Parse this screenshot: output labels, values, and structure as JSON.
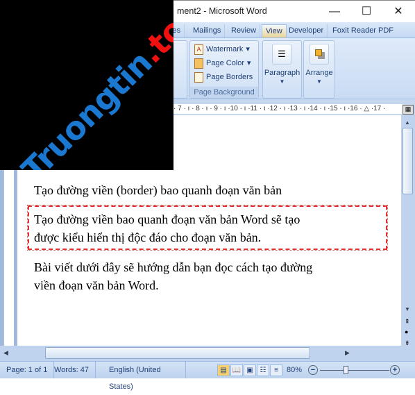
{
  "window": {
    "title": "ment2 - Microsoft Word",
    "minimize": "—",
    "maximize": "☐",
    "close": "✕"
  },
  "tabs": [
    {
      "label": "ces"
    },
    {
      "label": "Mailings"
    },
    {
      "label": "Review"
    },
    {
      "label": "View",
      "active": true
    },
    {
      "label": "Developer"
    },
    {
      "label": "Foxit Reader PDF"
    }
  ],
  "help": "?",
  "ribbon": {
    "page_background": {
      "label": "Page Background",
      "items": [
        {
          "label": "Watermark",
          "icon": "watermark-icon"
        },
        {
          "label": "Page Color",
          "icon": "page-color-icon"
        },
        {
          "label": "Page Borders",
          "icon": "page-borders-icon"
        }
      ]
    },
    "paragraph": {
      "label": "Paragraph"
    },
    "arrange": {
      "label": "Arrange"
    }
  },
  "ruler": "· 7 · ı · 8 · ı · 9 · ı ·10 · ı ·11 · ı ·12 · ı ·13 · ı ·14 · ı ·15 · ı ·16 · △ ·17 ·",
  "watermark_logo": "Truongtin.top",
  "document": {
    "heading": "Tạo đường viền (border) bao quanh đoạn văn bản",
    "bordered_paragraph": [
      "Tạo đường viền bao quanh đoạn văn bản Word sẽ tạo",
      "được kiểu hiển thị độc đáo cho đoạn văn bản."
    ],
    "paragraph": [
      "Bài viết dưới đây sẽ hướng dẫn bạn đọc cách tạo đường",
      "viền đoạn văn bản Word."
    ],
    "border_color": "#e03030"
  },
  "status": {
    "page": "Page: 1 of 1",
    "words": "Words: 47",
    "language": "English (United States)",
    "zoom": "80%",
    "zoom_value": 80
  }
}
